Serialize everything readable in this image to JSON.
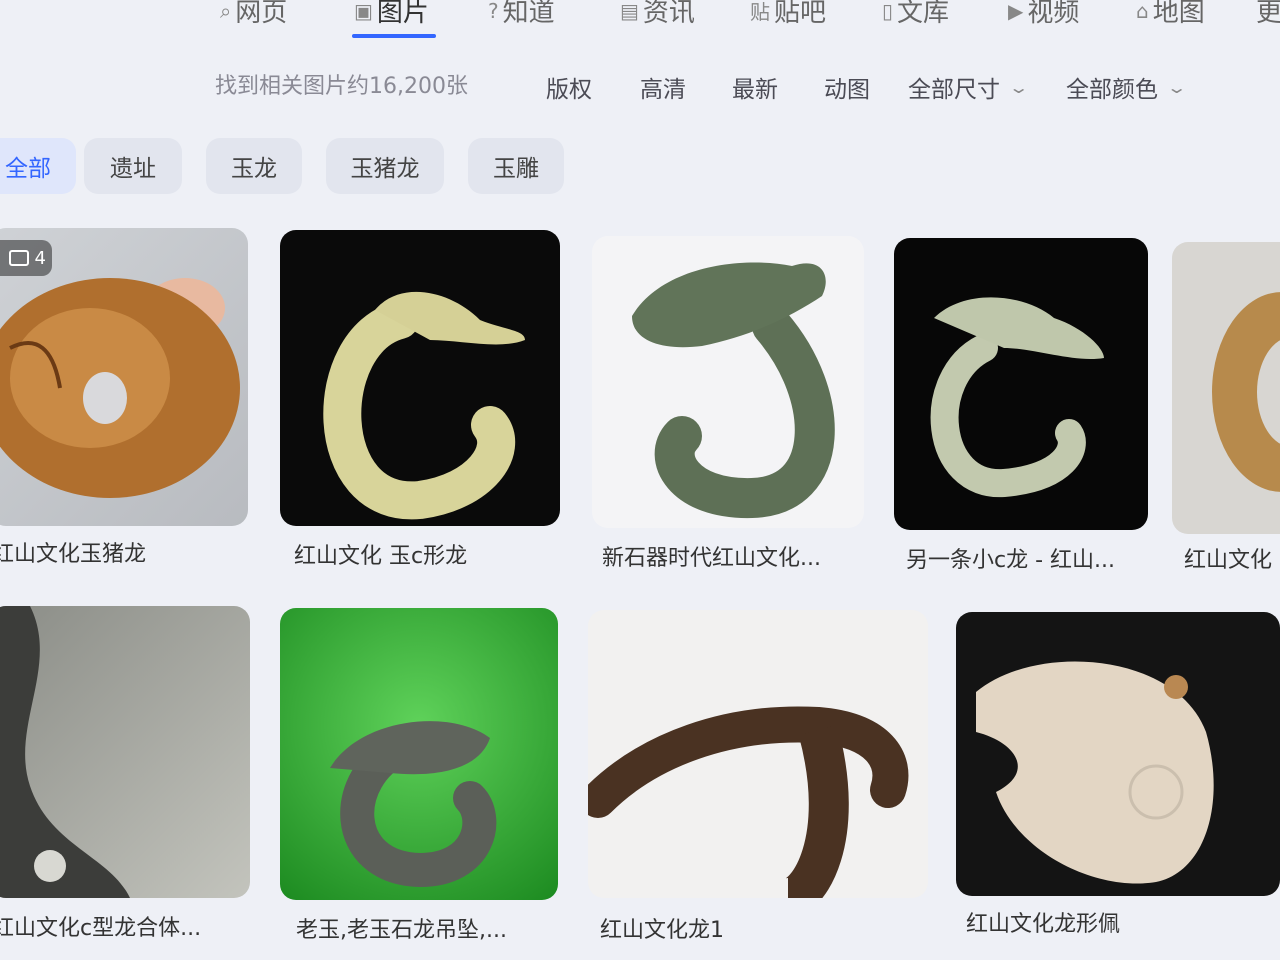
{
  "nav": {
    "tabs": [
      {
        "label": "网页",
        "icon": "search-icon"
      },
      {
        "label": "图片",
        "icon": "image-icon",
        "active": true
      },
      {
        "label": "知道",
        "icon": "question-icon"
      },
      {
        "label": "资讯",
        "icon": "news-icon"
      },
      {
        "label": "贴吧",
        "icon": "tieba-icon"
      },
      {
        "label": "文库",
        "icon": "document-icon"
      },
      {
        "label": "视频",
        "icon": "video-icon"
      },
      {
        "label": "地图",
        "icon": "map-icon"
      },
      {
        "label": "更",
        "icon": ""
      }
    ]
  },
  "filters": {
    "result_count": "找到相关图片约16,200张",
    "items": [
      "版权",
      "高清",
      "最新",
      "动图",
      "全部尺寸",
      "全部颜色"
    ]
  },
  "chips": [
    "全部",
    "遗址",
    "玉龙",
    "玉猪龙",
    "玉雕"
  ],
  "results": {
    "badge_count": "4",
    "captions": [
      "红山文化玉猪龙",
      "红山文化 玉c形龙",
      "新石器时代红山文化...",
      "另一条小c龙 - 红山...",
      "红山文化",
      "红山文化c型龙合体...",
      "老玉,老玉石龙吊坠,...",
      "红山文化龙1",
      "红山文化龙形佩"
    ]
  },
  "colors": {
    "accent": "#3366ff",
    "page_bg": "#eef0f6"
  }
}
